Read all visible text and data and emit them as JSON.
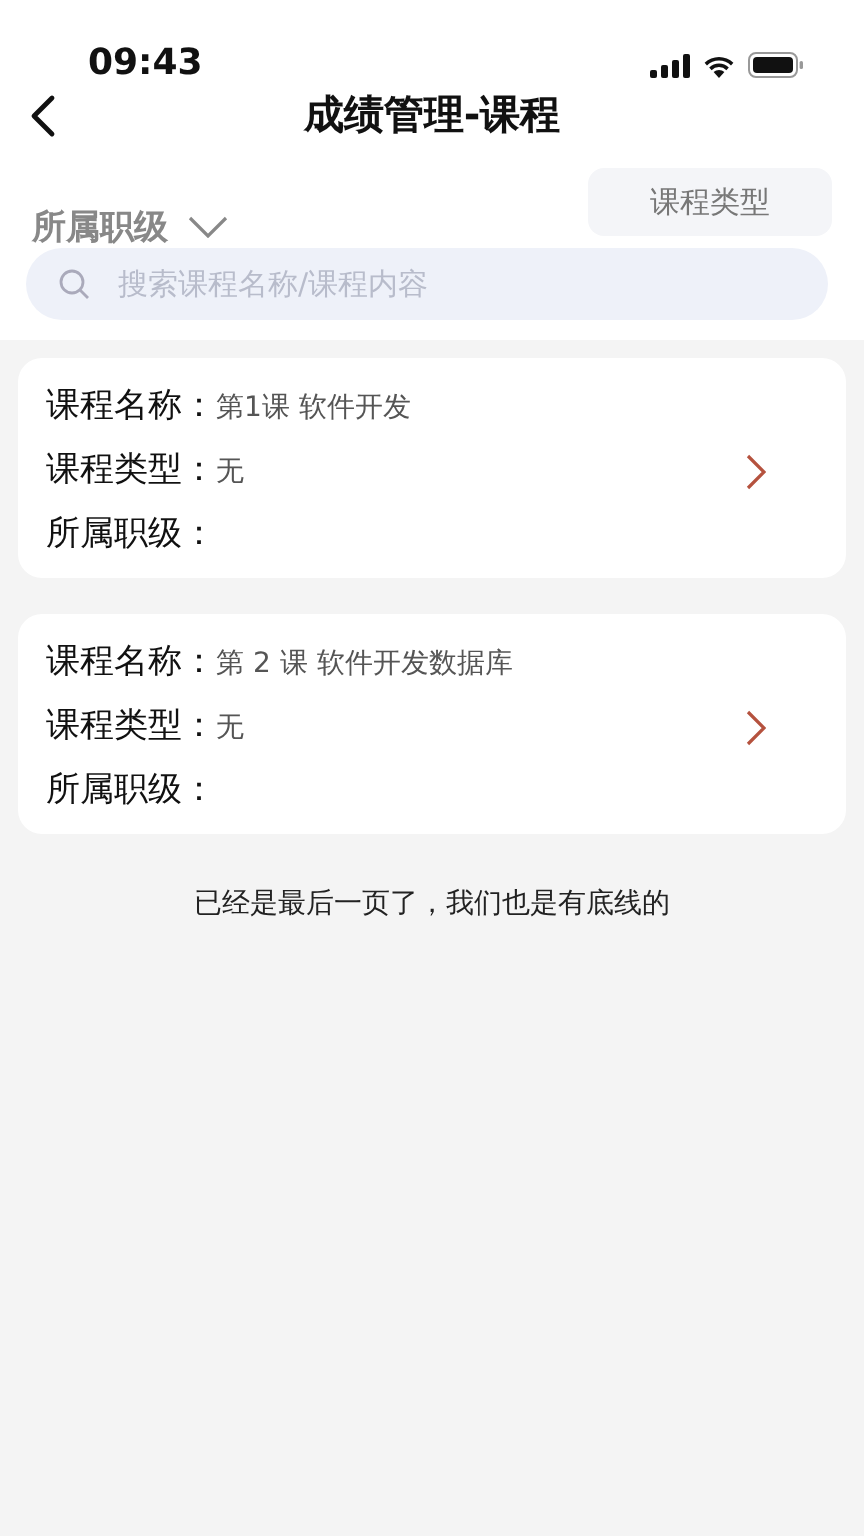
{
  "status_bar": {
    "time": "09:43"
  },
  "header": {
    "title": "成绩管理-课程"
  },
  "filters": {
    "level_dropdown": "所属职级",
    "type_button": "课程类型"
  },
  "search": {
    "placeholder": "搜索课程名称/课程内容"
  },
  "courses": [
    {
      "fields": [
        {
          "label": "课程名称：",
          "value": "第1课 软件开发"
        },
        {
          "label": "课程类型：",
          "value": "无"
        },
        {
          "label": "所属职级："
        }
      ]
    },
    {
      "fields": [
        {
          "label": "课程名称：",
          "value": "第 2 课 软件开发数据库"
        },
        {
          "label": "课程类型：",
          "value": "无"
        },
        {
          "label": "所属职级："
        }
      ]
    }
  ],
  "footer_note": "已经是最后一页了，我们也是有底线的"
}
